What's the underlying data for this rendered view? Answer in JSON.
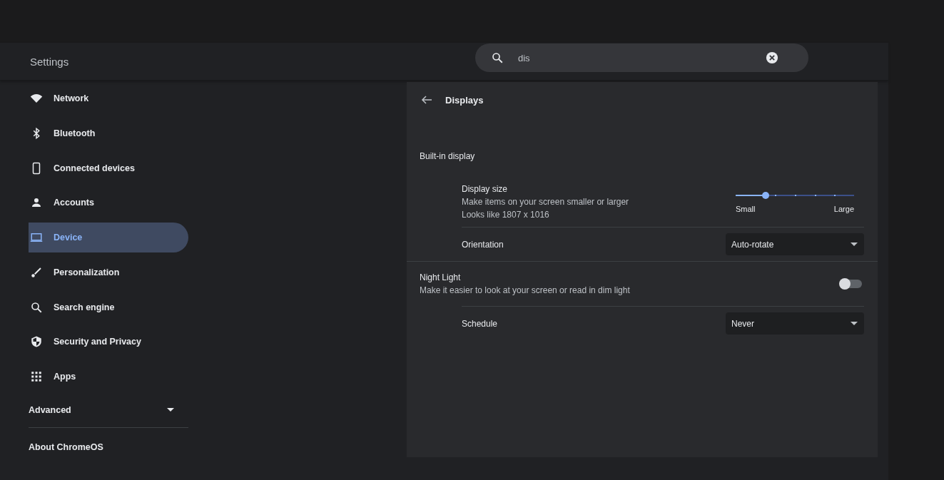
{
  "header": {
    "title": "Settings",
    "search": {
      "value": "dis"
    }
  },
  "sidebar": {
    "items": [
      {
        "label": "Network",
        "kind": "wifi",
        "selected": false
      },
      {
        "label": "Bluetooth",
        "kind": "bluetooth",
        "selected": false
      },
      {
        "label": "Connected devices",
        "kind": "phone",
        "selected": false
      },
      {
        "label": "Accounts",
        "kind": "person",
        "selected": false
      },
      {
        "label": "Device",
        "kind": "laptop",
        "selected": true
      },
      {
        "label": "Personalization",
        "kind": "brush",
        "selected": false
      },
      {
        "label": "Search engine",
        "kind": "search",
        "selected": false
      },
      {
        "label": "Security and Privacy",
        "kind": "shield",
        "selected": false
      },
      {
        "label": "Apps",
        "kind": "grid",
        "selected": false
      }
    ],
    "advanced": {
      "label": "Advanced",
      "expanded": false
    },
    "about": "About ChromeOS"
  },
  "page": {
    "title": "Displays",
    "section": "Built-in display",
    "rows": [
      {
        "kind": "slider",
        "title": "Display size",
        "lines": [
          "Make items on your screen smaller or larger",
          "Looks like 1807 x 1016"
        ],
        "level": 0.25,
        "min_label": "Small",
        "max_label": "Large"
      },
      {
        "kind": "select",
        "title": "Orientation",
        "value": "Auto-rotate"
      },
      {
        "kind": "toggle",
        "title": "Night Light",
        "lines": [
          "Make it easier to look at your screen or read in dim light"
        ],
        "on": false
      },
      {
        "kind": "select",
        "title": "Schedule",
        "value": "Never"
      }
    ]
  }
}
